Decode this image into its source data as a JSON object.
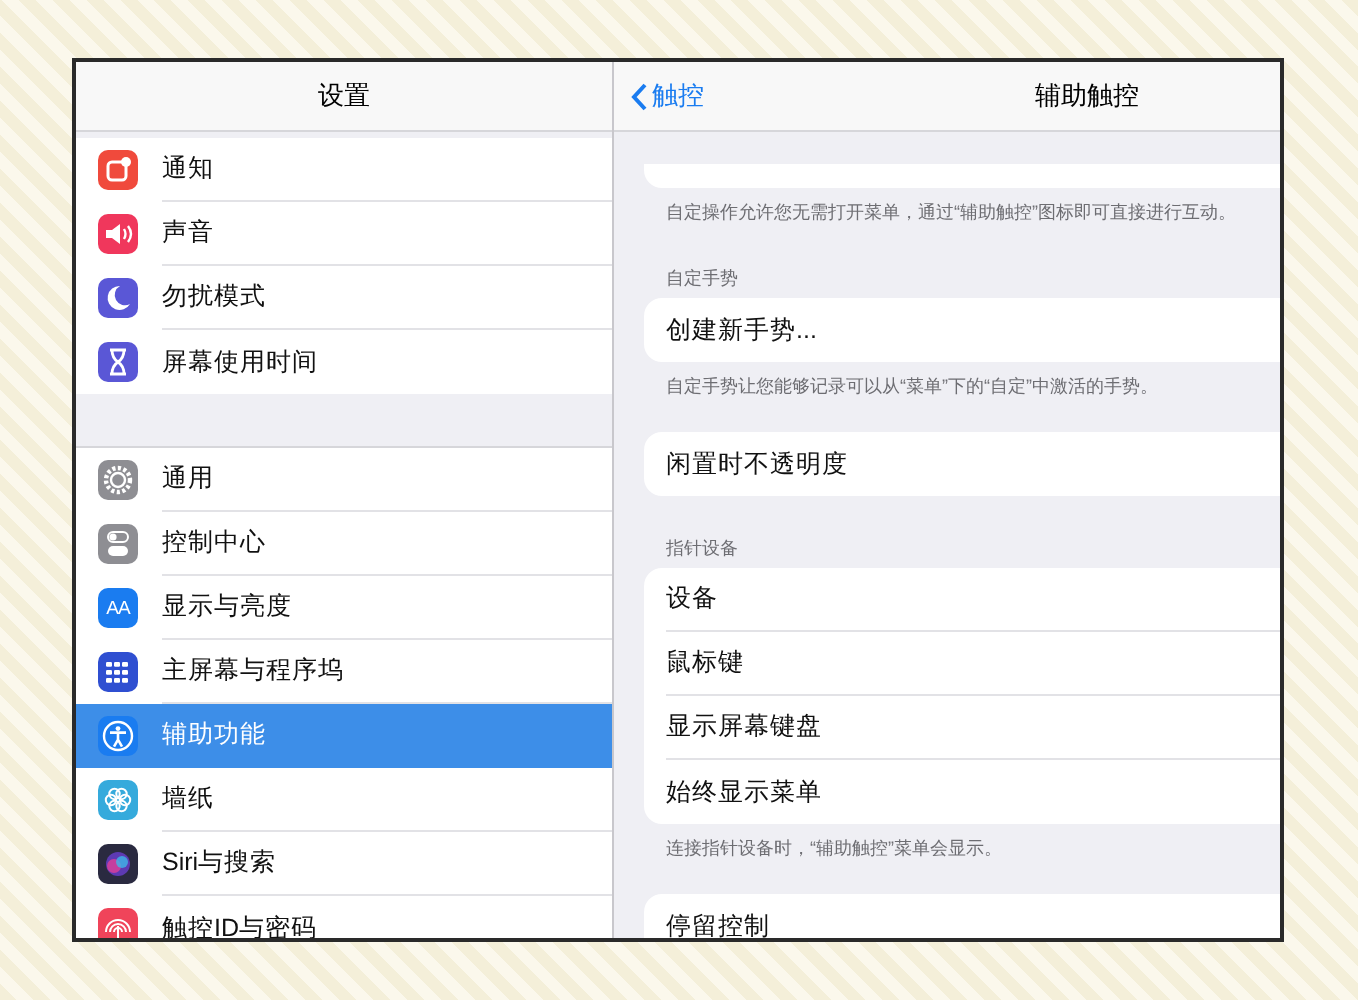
{
  "sidebar": {
    "title": "设置",
    "groups": [
      {
        "items": [
          {
            "label": "通知",
            "color": "#f04a3c",
            "selected": false
          },
          {
            "label": "声音",
            "color": "#f0375c",
            "selected": false
          },
          {
            "label": "勿扰模式",
            "color": "#5a57d6",
            "selected": false
          },
          {
            "label": "屏幕使用时间",
            "color": "#5a57d6",
            "selected": false
          }
        ]
      },
      {
        "items": [
          {
            "label": "通用",
            "color": "#8e8e93",
            "selected": false
          },
          {
            "label": "控制中心",
            "color": "#8e8e93",
            "selected": false
          },
          {
            "label": "显示与亮度",
            "color": "#1a7cf0",
            "selected": false,
            "icon_text": "AA"
          },
          {
            "label": "主屏幕与程序坞",
            "color": "#2f4fd1",
            "selected": false
          },
          {
            "label": "辅助功能",
            "color": "#1a7cf0",
            "selected": true
          },
          {
            "label": "墙纸",
            "color": "#35aadc",
            "selected": false
          },
          {
            "label": "Siri与搜索",
            "color": "#2a2a40",
            "selected": false
          },
          {
            "label": "触控ID与密码",
            "color": "#f0445a",
            "selected": false
          }
        ]
      }
    ]
  },
  "detail": {
    "back": "触控",
    "title": "辅助触控",
    "sections": [
      {
        "kind": "cut",
        "footer": "自定操作允许您无需打开菜单，通过“辅助触控”图标即可直接进行互动。"
      },
      {
        "kind": "list",
        "header": "自定手势",
        "rows": [
          {
            "label": "创建新手势..."
          }
        ],
        "footer": "自定手势让您能够记录可以从“菜单”下的“自定”中激活的手势。"
      },
      {
        "kind": "list",
        "rows": [
          {
            "label": "闲置时不透明度"
          }
        ]
      },
      {
        "kind": "list",
        "header": "指针设备",
        "rows": [
          {
            "label": "设备"
          },
          {
            "label": "鼠标键"
          },
          {
            "label": "显示屏幕键盘"
          },
          {
            "label": "始终显示菜单"
          }
        ],
        "footer": "连接指针设备时，“辅助触控”菜单会显示。"
      },
      {
        "kind": "list",
        "rows": [
          {
            "label": "停留控制"
          }
        ]
      }
    ]
  }
}
